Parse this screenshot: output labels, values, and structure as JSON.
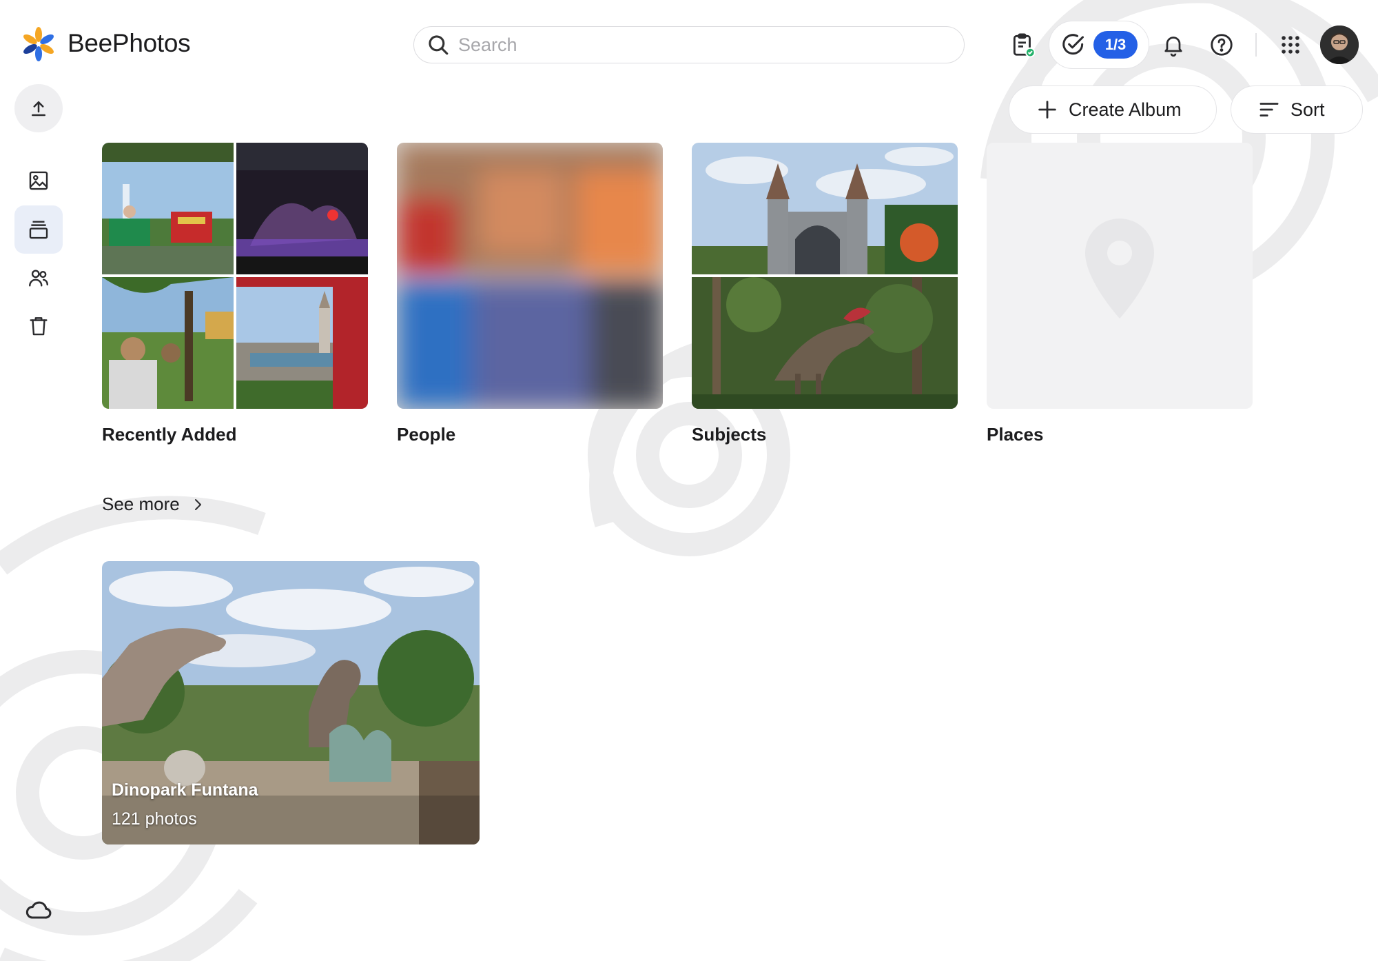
{
  "app": {
    "title": "BeePhotos"
  },
  "search": {
    "placeholder": "Search",
    "value": ""
  },
  "header": {
    "tasks_badge": "1/3",
    "icons": [
      "clipboard-check-icon",
      "task-check-icon",
      "bell-icon",
      "help-icon",
      "apps-grid-icon"
    ]
  },
  "rail": {
    "items": [
      "upload-icon",
      "photos-icon",
      "albums-icon",
      "people-icon",
      "trash-icon"
    ],
    "active": "albums"
  },
  "toolbar": {
    "create_album_label": "Create Album",
    "sort_label": "Sort"
  },
  "categories": [
    {
      "label": "Recently Added"
    },
    {
      "label": "People"
    },
    {
      "label": "Subjects"
    },
    {
      "label": "Places"
    }
  ],
  "see_more": {
    "label": "See more"
  },
  "albums": [
    {
      "title": "Dinopark Funtana",
      "count": "121 photos"
    }
  ],
  "colors": {
    "accent": "#2460e6",
    "active_rail_bg": "#e9eef8",
    "pill_border": "#e4e4e7"
  }
}
